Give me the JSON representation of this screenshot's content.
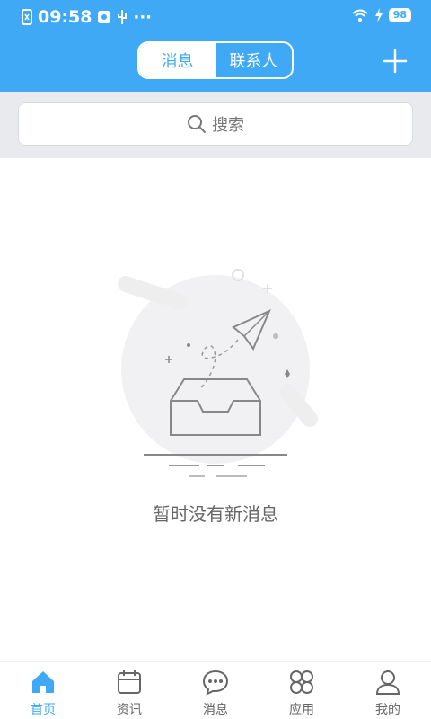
{
  "status": {
    "time": "09:58",
    "battery": "98",
    "icons": [
      "sim-icon",
      "usb-icon",
      "more-dots-icon",
      "wifi-icon",
      "charging-icon",
      "battery-icon"
    ]
  },
  "header": {
    "tabs": [
      {
        "label": "消息",
        "active": true
      },
      {
        "label": "联系人",
        "active": false
      }
    ],
    "add_icon": "plus-icon",
    "accent": "#3fa9f5"
  },
  "search": {
    "placeholder": "搜索"
  },
  "empty": {
    "text": "暂时没有新消息"
  },
  "tabbar": {
    "items": [
      {
        "label": "首页",
        "icon": "home-icon",
        "active": true
      },
      {
        "label": "资讯",
        "icon": "calendar-icon",
        "active": false
      },
      {
        "label": "消息",
        "icon": "chat-icon",
        "active": false
      },
      {
        "label": "应用",
        "icon": "apps-icon",
        "active": false
      },
      {
        "label": "我的",
        "icon": "user-icon",
        "active": false
      }
    ]
  }
}
